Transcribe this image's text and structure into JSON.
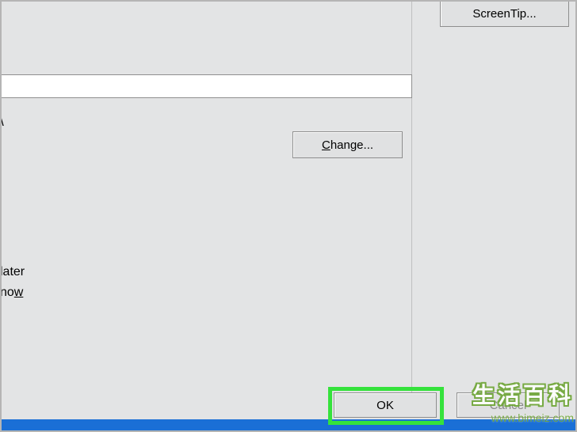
{
  "buttons": {
    "screentip": "ScreenTip...",
    "change_pre": "C",
    "change_post": "hange...",
    "ok": "OK",
    "cancel": "Cancel"
  },
  "texts": {
    "backslash": "\\",
    "opt1_pre": "later",
    "opt2_pre": "no",
    "opt2_u": "w"
  },
  "input": {
    "value": ""
  },
  "watermark": {
    "chars": "生活百科",
    "url": "www.bimeiz.com"
  }
}
